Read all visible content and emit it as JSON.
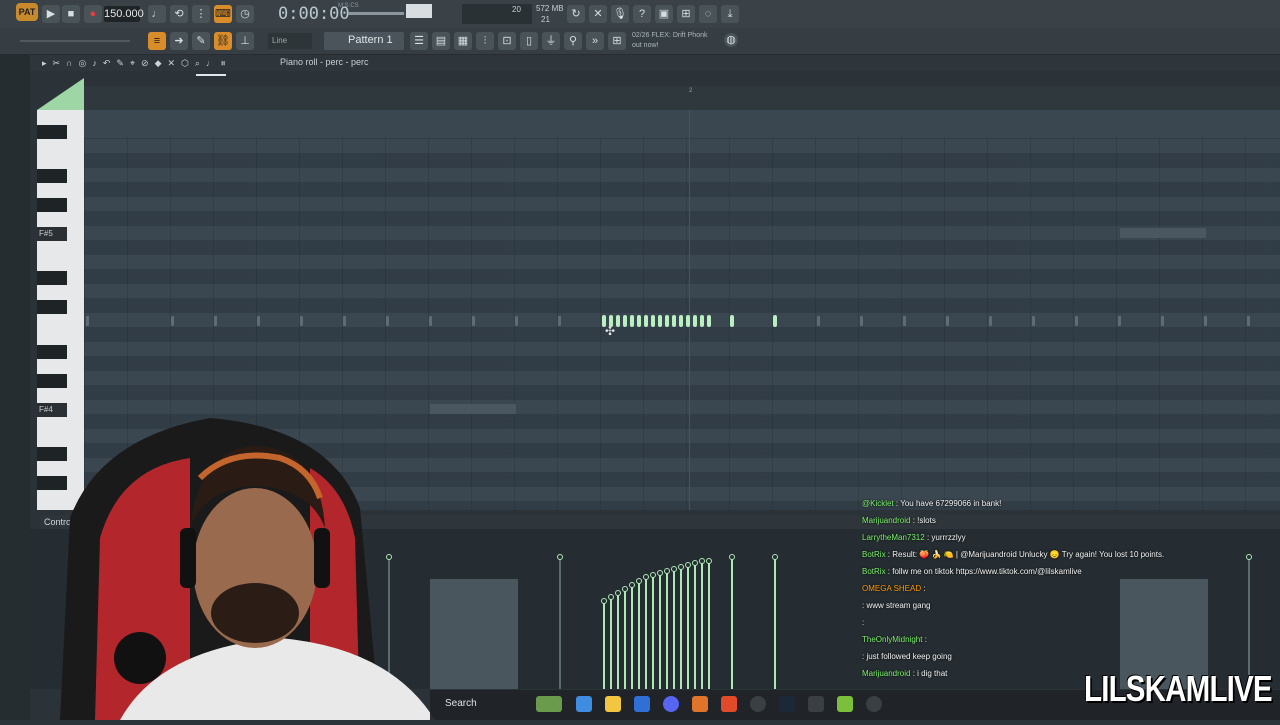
{
  "toolbar": {
    "pattern_badge": "PAT",
    "tempo": "150.000",
    "time": "0:00:00",
    "time_sub": "M:S:CS",
    "cpu": "20",
    "memory": "572 MB",
    "memory_sub": "21",
    "snap": "Line",
    "pattern": "Pattern 1",
    "hint_line1": "02/26  FLEX: Drift Phonk",
    "hint_line2": "out now!"
  },
  "piano_roll": {
    "title": "Piano roll - perc - perc",
    "ruler_marker": "2",
    "key_labels": [
      "F#5",
      "F#4"
    ]
  },
  "control": {
    "label": "Control"
  },
  "chat": [
    {
      "user": "@Kicklet",
      "text": ": You have 67299066 in bank!",
      "cls": "u-green"
    },
    {
      "user": "Marijuandroid",
      "text": ": !slots",
      "cls": "u-green"
    },
    {
      "user": "LarrytheMan7312",
      "text": ": yurrrzzlyy",
      "cls": "u-green"
    },
    {
      "user": "BotRix",
      "text": ": Result: 🍑 🍌 🍋 | @Marijuandroid Unlucky 😞 Try again! You lost 10 points.",
      "cls": "u-green"
    },
    {
      "user": "BotRix",
      "text": ": follw me on tiktok https://www.tiktok.com/@lilskamlive",
      "cls": "u-green"
    },
    {
      "user": "OMEGA SHEAD",
      "text": ":",
      "cls": "u-orange"
    },
    {
      "user": "",
      "text": ": www stream gang",
      "cls": "u-red"
    },
    {
      "user": "",
      "text": ":",
      "cls": "u-red"
    },
    {
      "user": "TheOnlyMidnight",
      "text": ":",
      "cls": "u-green"
    },
    {
      "user": "",
      "text": ": just followed keep going",
      "cls": "u-red"
    },
    {
      "user": "Marijuandroid",
      "text": ": i dig that",
      "cls": "u-green"
    }
  ],
  "taskbar": {
    "search": "Search"
  },
  "brand": "LILSKAMLIVE"
}
